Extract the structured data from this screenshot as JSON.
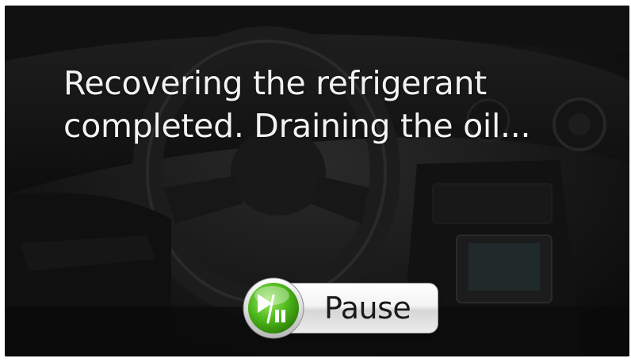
{
  "screen": {
    "message_line1": "Recovering the refrigerant",
    "message_line2": "completed. Draining the oil..."
  },
  "controls": {
    "pause_label": "Pause",
    "pause_icon": "play-pause-icon"
  },
  "colors": {
    "text": "#f2f2f2",
    "icon_green": "#4db81a",
    "background": "#0c0c0c"
  }
}
